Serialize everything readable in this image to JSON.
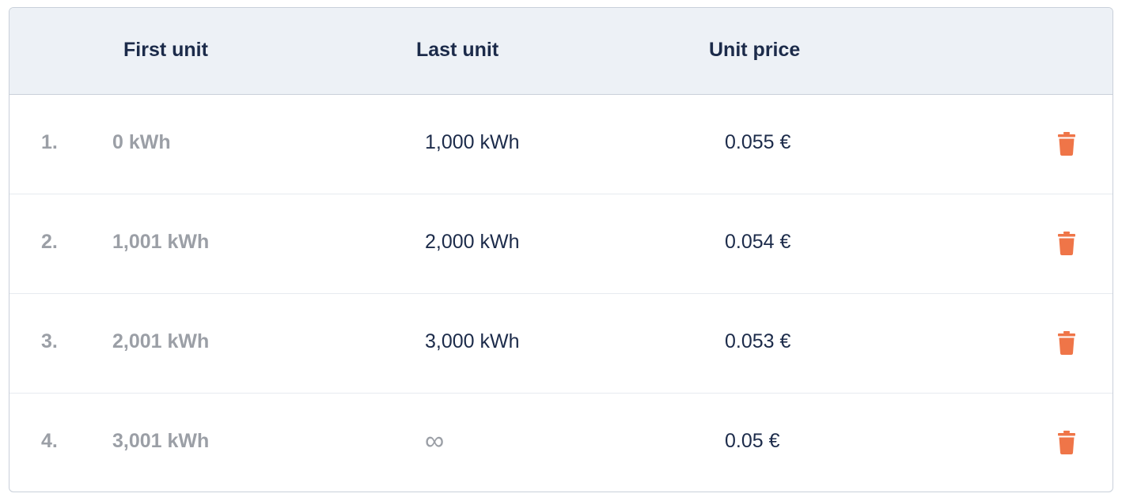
{
  "table": {
    "headers": {
      "index": "",
      "first_unit": "First unit",
      "last_unit": "Last unit",
      "unit_price": "Unit price"
    },
    "rows": [
      {
        "index": "1.",
        "first_unit": "0 kWh",
        "last_unit": "1,000 kWh",
        "unit_price": "0.055 €"
      },
      {
        "index": "2.",
        "first_unit": "1,001 kWh",
        "last_unit": "2,000 kWh",
        "unit_price": "0.054 €"
      },
      {
        "index": "3.",
        "first_unit": "2,001 kWh",
        "last_unit": "3,000 kWh",
        "unit_price": "0.053 €"
      },
      {
        "index": "4.",
        "first_unit": "3,001 kWh",
        "last_unit": "∞",
        "unit_price": "0.05 €"
      }
    ],
    "row_action_icon": "trash-icon"
  },
  "colors": {
    "header_bg": "#edf1f6",
    "header_text": "#1c2b4a",
    "muted_text": "#9b9fa6",
    "delete_icon": "#ef7548",
    "border": "#c9d0da"
  }
}
